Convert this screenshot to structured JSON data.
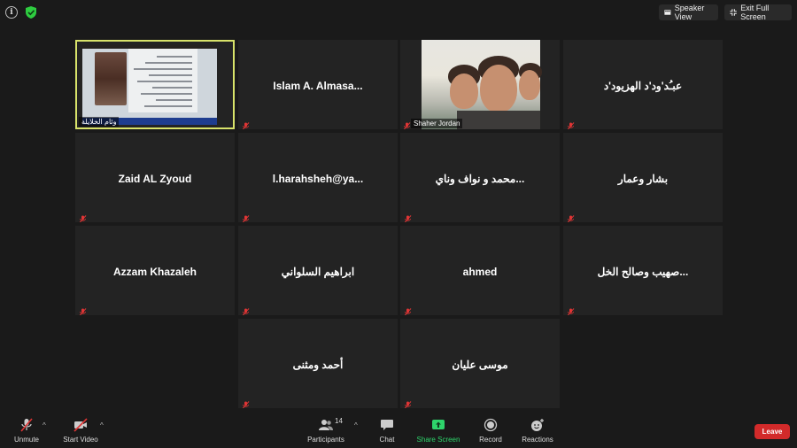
{
  "topbar": {
    "info_icon": "i",
    "speaker_view": "Speaker View",
    "exit_full_screen": "Exit Full Screen"
  },
  "participants": [
    {
      "name": "وئام الخلايلة",
      "video": true,
      "kind": "document",
      "active": true
    },
    {
      "name": "Islam A. Almasa...",
      "video": false
    },
    {
      "name": "Shaher Jordan",
      "video": true,
      "kind": "kids"
    },
    {
      "name": "عبـُد'ود'د الهزيود'د",
      "video": false
    },
    {
      "name": "Zaid AL Zyoud",
      "video": false
    },
    {
      "name": "l.harahsheh@ya...",
      "video": false
    },
    {
      "name": "محمد و نواف وناي...",
      "video": false
    },
    {
      "name": "بشار وعمار",
      "video": false
    },
    {
      "name": "Azzam Khazaleh",
      "video": false
    },
    {
      "name": "ابراهيم السلواني",
      "video": false
    },
    {
      "name": "ahmed",
      "video": false
    },
    {
      "name": "صهيب وصالح الخل...",
      "video": false
    },
    {
      "name": "أحمد ومثنى",
      "video": false
    },
    {
      "name": "موسى عليان",
      "video": false
    }
  ],
  "toolbar": {
    "unmute": "Unmute",
    "start_video": "Start Video",
    "participants": "Participants",
    "participants_count": "14",
    "chat": "Chat",
    "share_screen": "Share Screen",
    "record": "Record",
    "reactions": "Reactions",
    "leave": "Leave",
    "caret": "^"
  },
  "colors": {
    "background": "#1a1a1a",
    "tile": "#232323",
    "active_border": "#d8e36a",
    "share_green": "#2ed46b",
    "leave_red": "#d22a2a",
    "mute_red": "#e03535"
  }
}
